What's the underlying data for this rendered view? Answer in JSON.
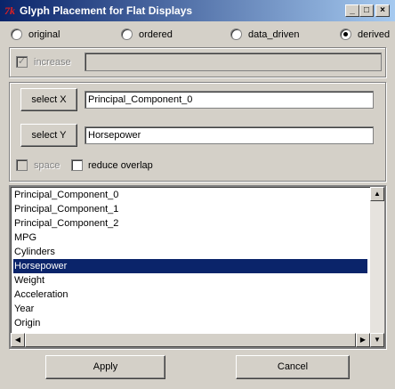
{
  "window": {
    "title": "Glyph Placement for Flat Displays",
    "app_icon_glyph": "7k",
    "controls": {
      "minimize": "_",
      "maximize": "□",
      "close": "×"
    }
  },
  "modes": [
    {
      "label": "original",
      "selected": false
    },
    {
      "label": "ordered",
      "selected": false
    },
    {
      "label": "data_driven",
      "selected": false
    },
    {
      "label": "derived",
      "selected": true
    }
  ],
  "increase": {
    "label": "increase",
    "checked": true,
    "enabled": false,
    "value": ""
  },
  "select_x": {
    "button_label": "select X",
    "value": "Principal_Component_0"
  },
  "select_y": {
    "button_label": "select Y",
    "value": "Horsepower"
  },
  "options": {
    "space": {
      "label": "space",
      "checked": false,
      "enabled": false
    },
    "reduce_overlap": {
      "label": "reduce overlap",
      "checked": false,
      "enabled": true
    }
  },
  "attributes": {
    "items": [
      "Principal_Component_0",
      "Principal_Component_1",
      "Principal_Component_2",
      "MPG",
      "Cylinders",
      "Horsepower",
      "Weight",
      "Acceleration",
      "Year",
      "Origin"
    ],
    "selected": "Horsepower"
  },
  "footer": {
    "apply_label": "Apply",
    "cancel_label": "Cancel"
  },
  "colors": {
    "title_start": "#0a246a",
    "title_end": "#a6caf0",
    "selection": "#0a246a",
    "face": "#d4d0c8"
  }
}
